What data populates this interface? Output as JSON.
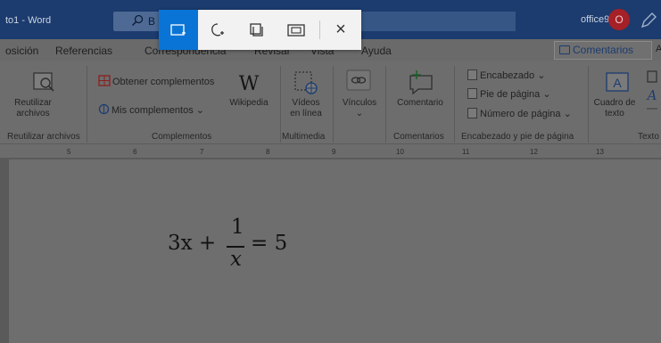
{
  "titlebar": {
    "doc_title": "to1 - Word",
    "search_text": "B",
    "user_name": "office9",
    "avatar_text": "O"
  },
  "tabs": [
    "osición",
    "Referencias",
    "Correspondencia",
    "Revisar",
    "Vista",
    "Ayuda"
  ],
  "comments_button": "Comentarios",
  "tab_extra": "A",
  "ribbon": {
    "reuse": {
      "label_line1": "Reutilizar",
      "label_line2": "archivos",
      "group": "Reutilizar archivos"
    },
    "addins": {
      "get_addins": "Obtener complementos",
      "my_addins": "Mis complementos",
      "my_addins_arrow": "⌄",
      "wikipedia": "Wikipedia",
      "group": "Complementos"
    },
    "media": {
      "label_line1": "Vídeos",
      "label_line2": "en línea",
      "group": "Multimedia"
    },
    "links": {
      "label": "Vínculos",
      "arrow": "⌄"
    },
    "comments": {
      "label": "Comentario",
      "group": "Comentarios"
    },
    "header_footer": {
      "header": "Encabezado",
      "footer": "Pie de página",
      "page_number": "Número de página",
      "arrow": "⌄",
      "group": "Encabezado y pie de página"
    },
    "text": {
      "textbox_line1": "Cuadro de",
      "textbox_line2": "texto",
      "arrow": "⌄",
      "group": "Texto"
    }
  },
  "ruler": {
    "ticks": [
      "5",
      "6",
      "7",
      "8",
      "9",
      "10",
      "11",
      "12",
      "13"
    ]
  },
  "equation": {
    "left": "3x +",
    "numerator": "1",
    "denominator": "x",
    "right": "= 5"
  },
  "snip_toolbar": {
    "modes": [
      "rectangular-snip",
      "freeform-snip",
      "window-snip",
      "fullscreen-snip"
    ],
    "active_mode": "rectangular-snip",
    "close": "×"
  },
  "colors": {
    "snip_active": "#0a74d6",
    "titlebar": "#1c3b6e",
    "overlay_dim": "#5a5a5a"
  }
}
